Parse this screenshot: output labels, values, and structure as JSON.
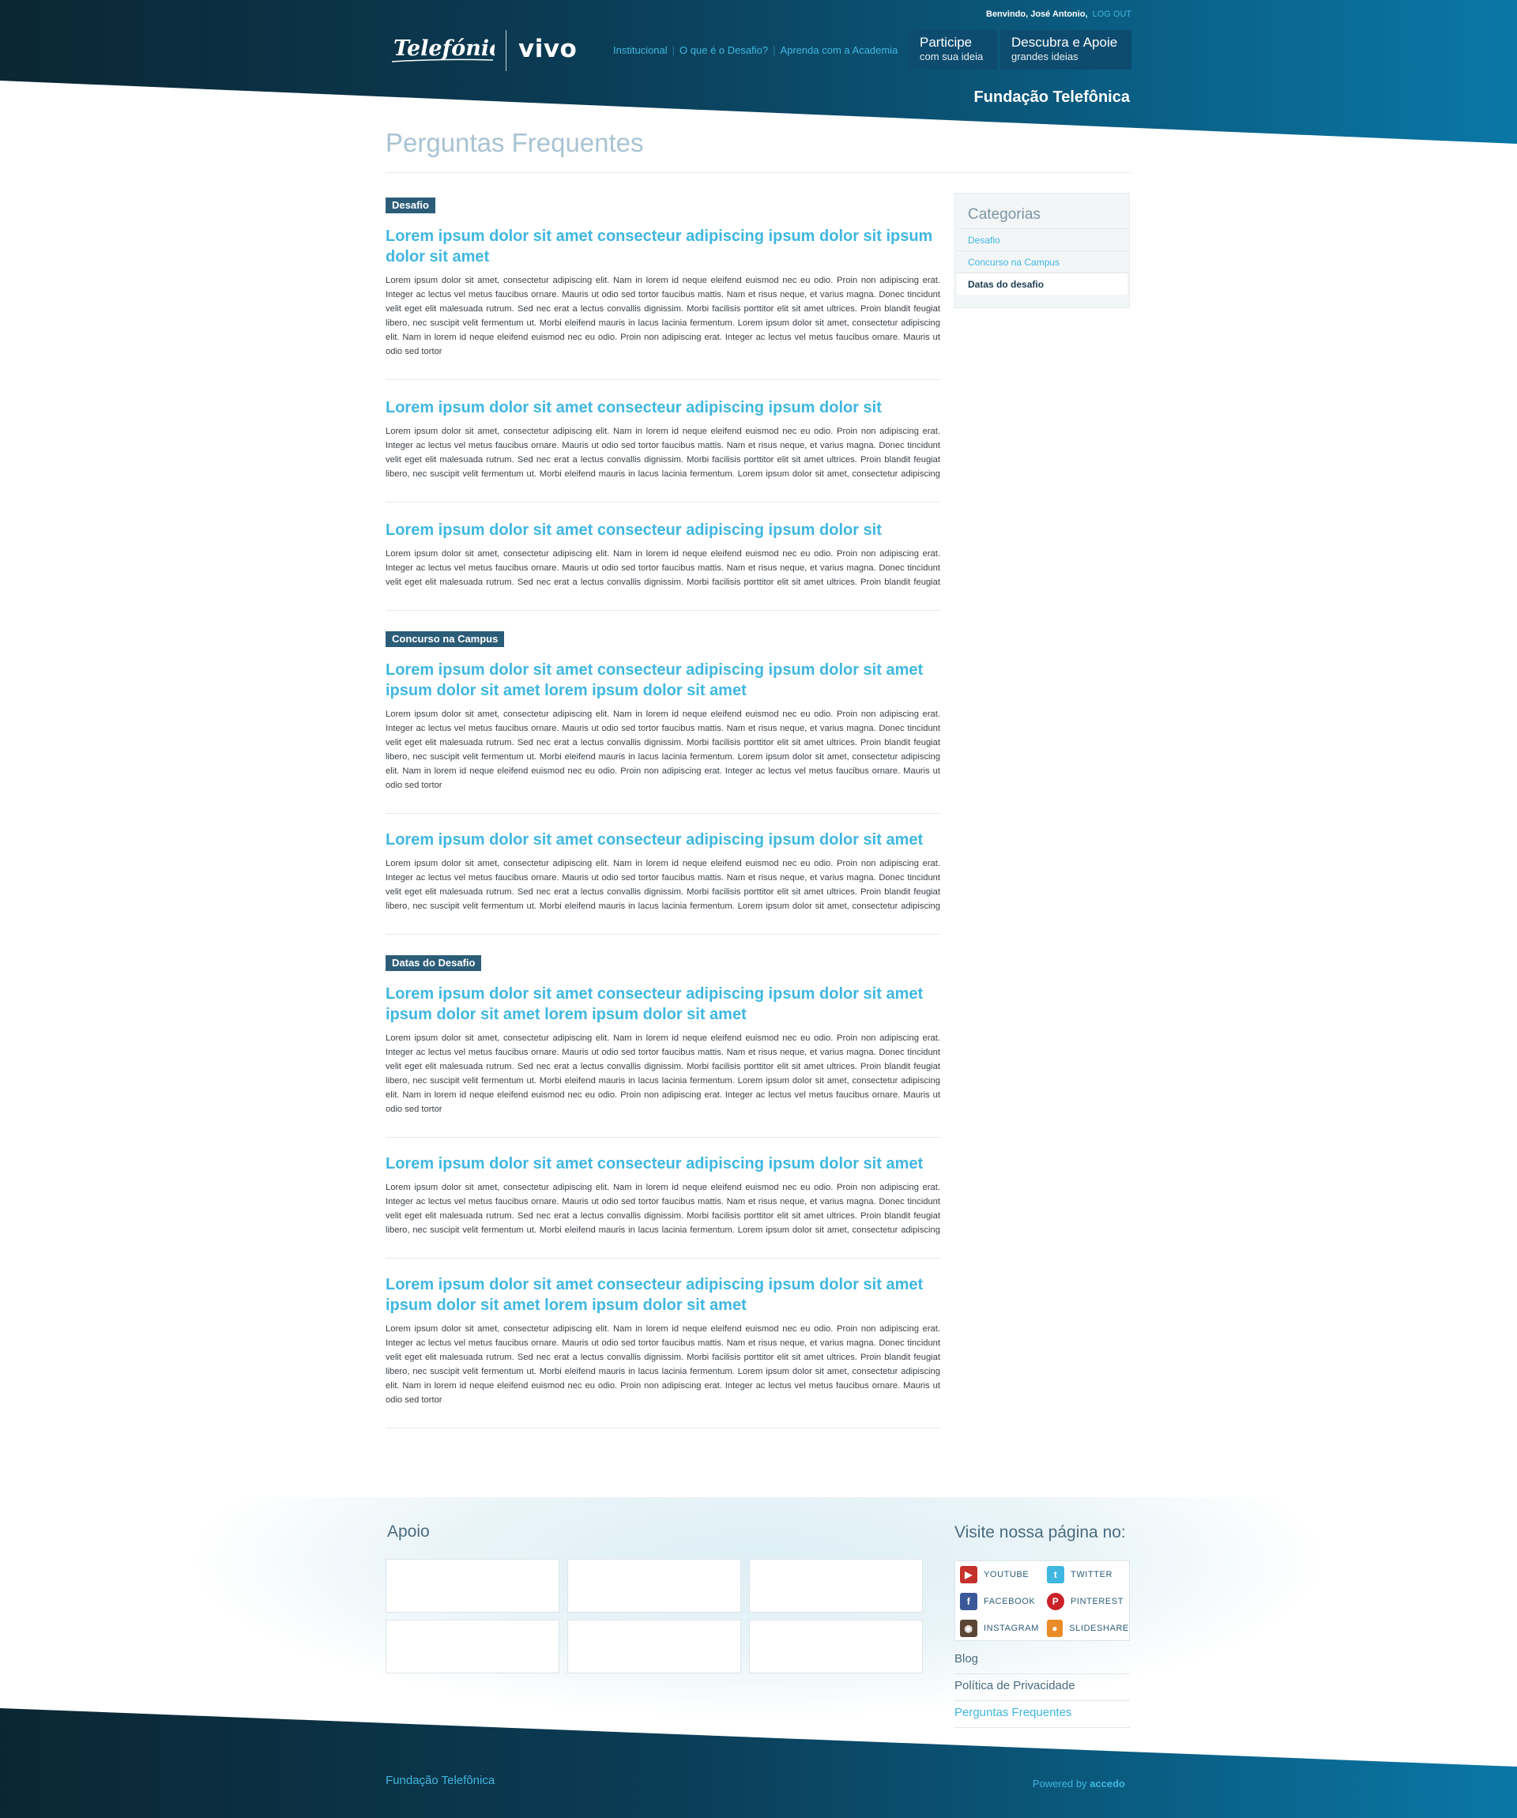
{
  "header": {
    "welcome": "Benvindo, José Antonio,",
    "logout": "LOG OUT",
    "logo_telefonica": "Telefónica",
    "logo_vivo": "vivo",
    "nav": [
      "Institucional",
      "O que é o Desafio?",
      "Aprenda com a Academia"
    ],
    "btn_participe": {
      "title": "Participe",
      "subtitle": "com sua ideia"
    },
    "btn_descubra": {
      "title": "Descubra e Apoie",
      "subtitle": "grandes ideias"
    },
    "brand": "Fundação Telefônica",
    "colors": {
      "dark": "#0b2633",
      "blue": "#0a77a6",
      "accent": "#3fb7e0"
    }
  },
  "main": {
    "title": "Perguntas Frequentes",
    "question_long": "Lorem ipsum dolor sit amet consecteur adipiscing ipsum dolor sit ipsum dolor sit amet",
    "question_short": "Lorem ipsum dolor sit amet consecteur adipiscing ipsum dolor sit",
    "question_long2": "Lorem ipsum dolor sit amet consecteur adipiscing ipsum dolor sit amet ipsum dolor sit amet lorem ipsum dolor sit amet",
    "question_med": "Lorem ipsum dolor sit amet consecteur adipiscing ipsum dolor sit amet",
    "answer": "Lorem ipsum dolor sit amet, consectetur adipiscing elit. Nam in lorem id neque eleifend euismod nec eu odio. Proin non adipiscing erat. Integer ac lectus vel metus faucibus ornare. Mauris ut odio sed tortor faucibus mattis. Nam et risus neque, et varius magna. Donec tincidunt velit eget elit malesuada rutrum. Sed nec erat a lectus convallis dignissim. Morbi facilisis porttitor elit sit amet ultrices. Proin blandit feugiat libero, nec suscipit velit fermentum ut. Morbi eleifend mauris in lacus lacinia fermentum. Lorem ipsum dolor sit amet, consectetur adipiscing elit. Nam in lorem id neque eleifend euismod nec eu odio. Proin non adipiscing erat. Integer ac lectus vel metus faucibus ornare. Mauris ut odio sed tortor",
    "categories": [
      "Desafio",
      "Concurso na Campus",
      "Datas do Desafio"
    ]
  },
  "sidebar": {
    "title": "Categorias",
    "items": [
      "Desafio",
      "Concurso na Campus",
      "Datas do desafio"
    ]
  },
  "footer": {
    "apoio": "Apoio",
    "visite": "Visite nossa página no:",
    "social": [
      "YOUTUBE",
      "TWITTER",
      "FACEBOOK",
      "PINTEREST",
      "INSTAGRAM",
      "SLIDESHARE"
    ],
    "links": [
      "Blog",
      "Política de Privacidade",
      "Perguntas Frequentes"
    ],
    "brand": "Fundação Telefônica",
    "powered": "Powered by",
    "powered_brand": "accedo"
  }
}
